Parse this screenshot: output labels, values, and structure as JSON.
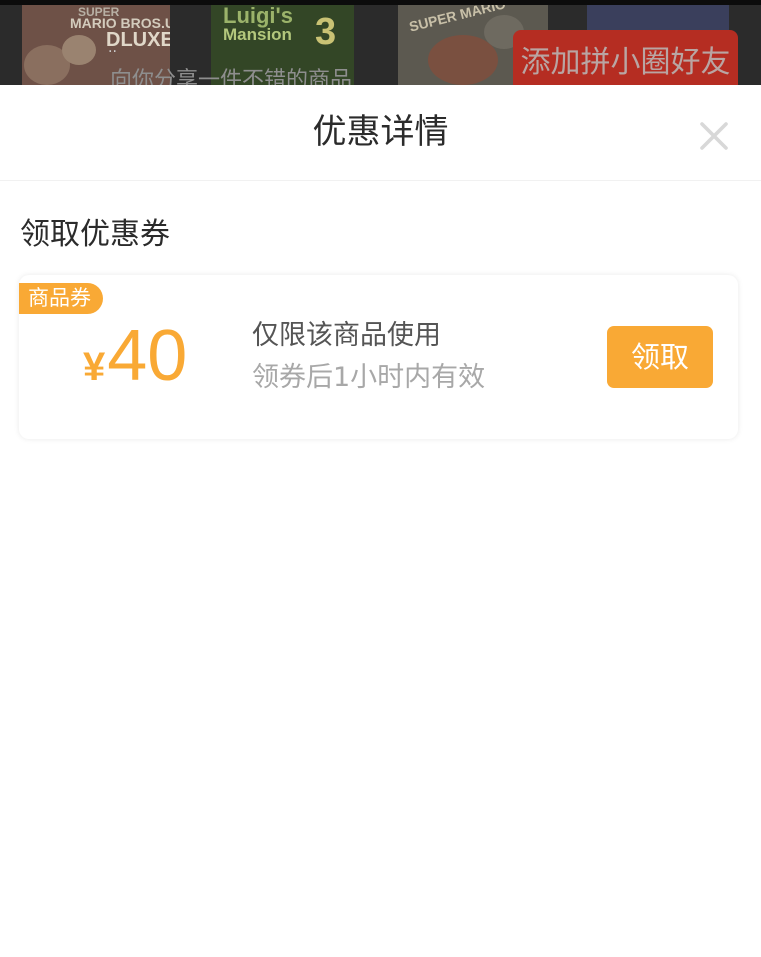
{
  "background": {
    "tile_texts": [
      "SUPER",
      "MARIO BROS.U",
      "DLUXE",
      "Luigi's",
      "Mansion",
      "3",
      "SUPER MARIO"
    ],
    "share_dots": "··",
    "share_text": "向你分享一件不错的商品",
    "friend_button_label": "添加拼小圈好友"
  },
  "sheet": {
    "title": "优惠详情",
    "close_icon": "close-icon",
    "section_title": "领取优惠券"
  },
  "coupon": {
    "tag": "商品券",
    "currency_symbol": "¥",
    "amount": "40",
    "description": "仅限该商品使用",
    "validity": "领券后1小时内有效",
    "claim_label": "领取"
  },
  "colors": {
    "accent": "#f9a935",
    "title_text": "#2b2b2b",
    "secondary_text": "#555555",
    "muted_text": "#a8a8a8",
    "close_icon": "#d8d8d8",
    "friend_button": "#b52d22"
  }
}
